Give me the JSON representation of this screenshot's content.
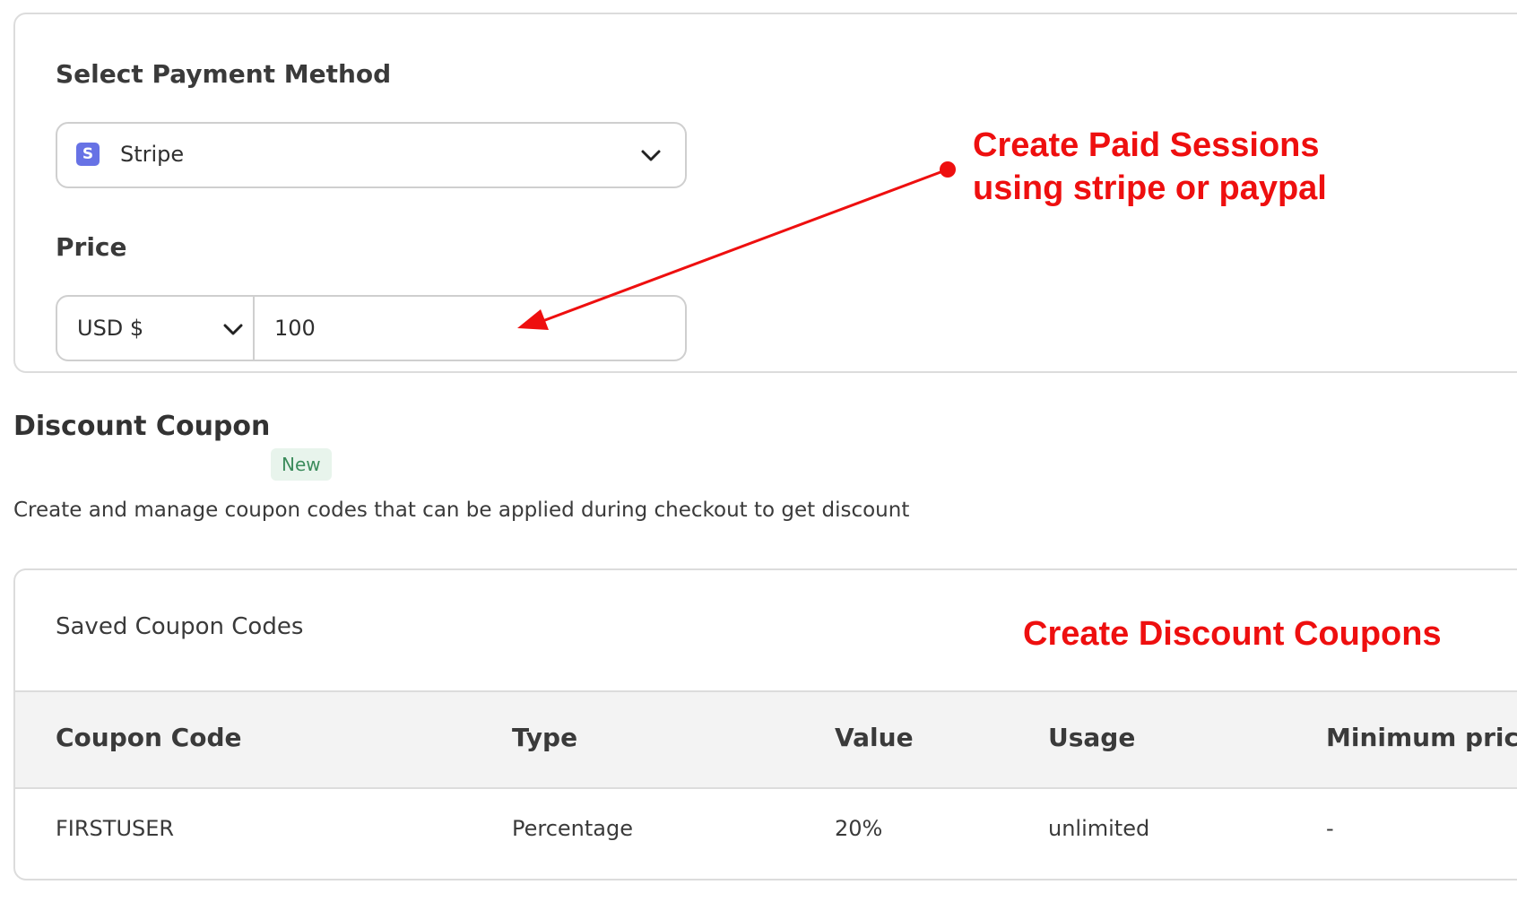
{
  "payment": {
    "method_label": "Select Payment Method",
    "method_value": "Stripe",
    "method_logo_letter": "S",
    "price_label": "Price",
    "currency_value": "USD $",
    "price_value": "100"
  },
  "discount": {
    "title": "Discount Coupon",
    "badge": "New",
    "description": "Create and manage coupon codes that can be applied during checkout to get discount"
  },
  "coupons": {
    "card_title": "Saved Coupon Codes",
    "columns": [
      "Coupon Code",
      "Type",
      "Value",
      "Usage",
      "Minimum price"
    ],
    "rows": [
      [
        "FIRSTUSER",
        "Percentage",
        "20%",
        "unlimited",
        "-"
      ]
    ]
  },
  "annotations": {
    "sessions_line1": "Create Paid Sessions",
    "sessions_line2": "using stripe or paypal",
    "coupons": "Create Discount Coupons"
  },
  "colors": {
    "annotation": "#ee0f0f",
    "stripe_brand": "#6772e5",
    "badge_bg": "#e8f4ec",
    "badge_text": "#3c8c5c"
  }
}
